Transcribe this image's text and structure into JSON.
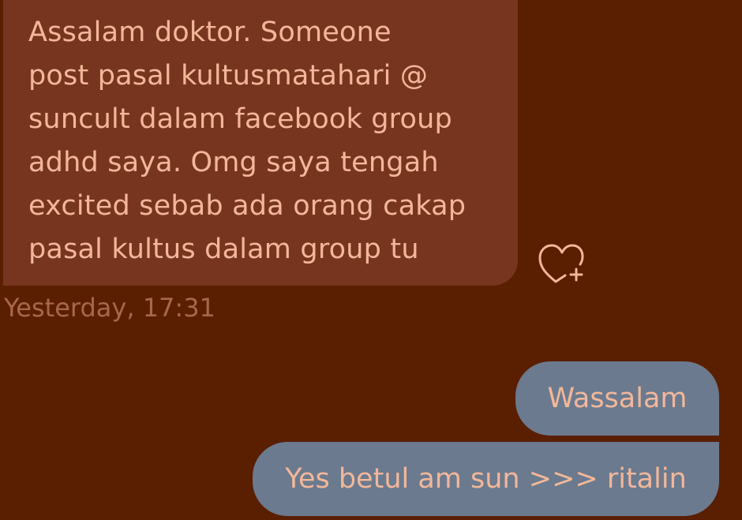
{
  "messages": {
    "incoming": {
      "text": "Assalam doktor. Someone\npost pasal kultusmatahari @\nsuncult dalam facebook group\nadhd saya. Omg saya tengah\nexcited sebab ada orang cakap\npasal kultus dalam group tu",
      "timestamp": "Yesterday, 17:31"
    },
    "outgoing": [
      {
        "text": "Wassalam"
      },
      {
        "text": "Yes betul am sun >>> ritalin"
      }
    ]
  },
  "reaction": {
    "icon": "heart-plus-icon"
  },
  "colors": {
    "background": "#5a1e00",
    "incoming_bubble": "#773520",
    "outgoing_bubble": "#6b7a8e",
    "text": "#f2b79a",
    "timestamp": "#a8674a"
  }
}
